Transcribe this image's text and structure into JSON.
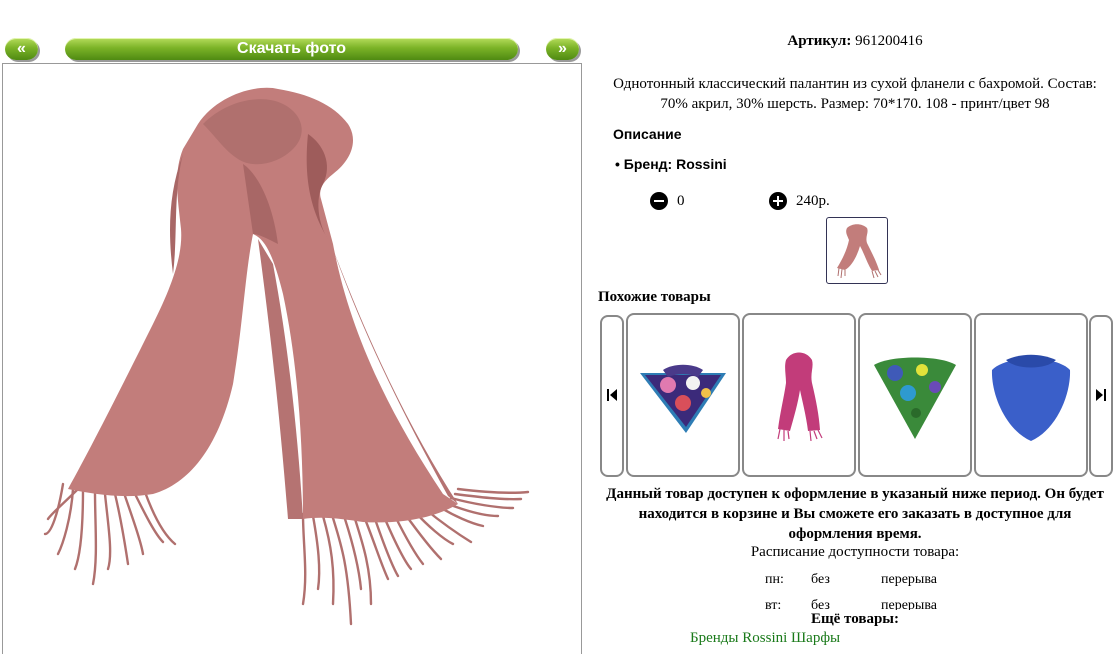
{
  "nav": {
    "prev_label": "«",
    "download_label": "Скачать фото",
    "next_label": "»"
  },
  "product": {
    "article_label": "Артикул:",
    "article_value": "961200416",
    "description_line1": "Однотонный классический палантин из сухой фланели с бахромой. Состав:",
    "description_line2": "70% акрил, 30% шерсть. Размер: 70*170. 108 - принт/цвет 98",
    "section_title": "Описание",
    "brand_line": "Бренд: Rossini",
    "quantity": "0",
    "price": "240р."
  },
  "similar": {
    "title": "Похожие товары"
  },
  "availability": {
    "notice_line1": "Данный товар доступен к оформление в указаный ниже период. Он будет",
    "notice_line2": "находится в корзине и Вы сможете его заказать в доступное для",
    "notice_line3": "оформления время.",
    "schedule_title": "Расписание доступности товара:",
    "rows": [
      {
        "day": "пн:",
        "a": "без",
        "b": "перерыва"
      },
      {
        "day": "вт:",
        "a": "без",
        "b": "перерыва"
      }
    ]
  },
  "more": {
    "title": "Ещё товары:",
    "link": "Бренды Rossini Шарфы"
  },
  "colors": {
    "scarf_main": "#c27d7b",
    "scarf_dark": "#9e5c5b",
    "link_green": "#1a7a1a"
  }
}
